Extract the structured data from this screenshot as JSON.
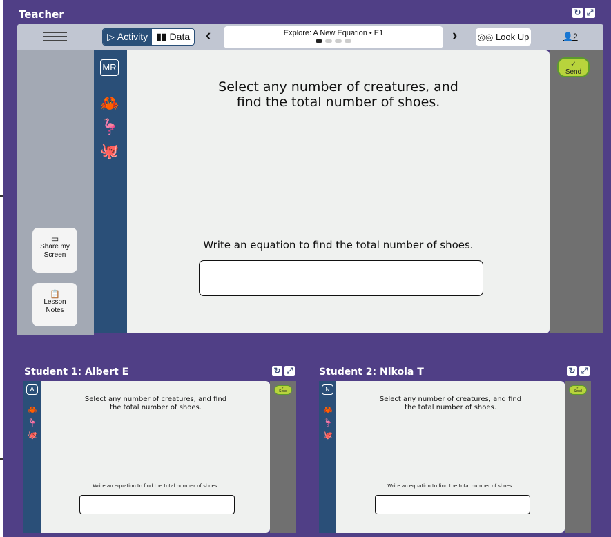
{
  "teacher": {
    "title": "Teacher",
    "menu_icon": "hamburger-icon",
    "tabs": [
      {
        "label": "Activity",
        "icon": "play-icon",
        "active": true
      },
      {
        "label": "Data",
        "icon": "bar-chart-icon",
        "active": false
      }
    ],
    "prev": "‹",
    "next": "›",
    "lesson_title": "Explore: A New Equation • E1",
    "pages": [
      true,
      false,
      false,
      false
    ],
    "lookup_label": "Look Up",
    "users_count": "2",
    "share_label": "Share my Screen",
    "notes_label": "Lesson Notes",
    "initials": "MR",
    "question": "Select any number of creatures, and find the total number of shoes.",
    "prompt": "Write an equation to find the total number of shoes.",
    "answer": "",
    "send_label": "Send"
  },
  "students": [
    {
      "title": "Student 1: Albert E",
      "initial": "A",
      "question": "Select any number of creatures, and find the total number of shoes.",
      "prompt": "Write an equation to find the total number of shoes.",
      "answer": "",
      "send_label": "Send"
    },
    {
      "title": "Student 2: Nikola T",
      "initial": "N",
      "question": "Select any number of creatures, and find the total number of shoes.",
      "prompt": "Write an equation to find the total number of shoes.",
      "answer": "",
      "send_label": "Send"
    }
  ],
  "colors": {
    "background": "#503f86",
    "strip": "#2a4f78",
    "send": "#b8d43c",
    "nav": "#c1c6d2"
  }
}
